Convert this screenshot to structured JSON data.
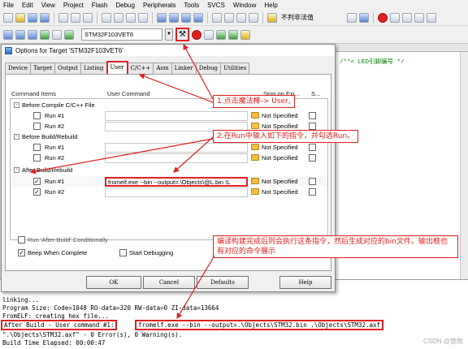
{
  "menubar": [
    "File",
    "Edit",
    "View",
    "Project",
    "Flash",
    "Debug",
    "Peripherals",
    "Tools",
    "SVCS",
    "Window",
    "Help"
  ],
  "toolbar": {
    "search_value": "不判非法值",
    "target_name": "STM32F103VET6"
  },
  "editor": {
    "code_line": "/**< LED引脚编号 */"
  },
  "dialog": {
    "title": "Options for Target 'STM32F103VET6'",
    "tabs": [
      "Device",
      "Target",
      "Output",
      "Listing",
      "User",
      "C/C++",
      "Asm",
      "Linker",
      "Debug",
      "Utilities"
    ],
    "active_tab": "User",
    "headers": {
      "command_items": "Command Items",
      "user_command": "User Command",
      "stop_on": "Stop on Exi...",
      "s": "S..."
    },
    "rows": [
      {
        "kind": "group",
        "label": "Before Compile C/C++ File",
        "expander": "-"
      },
      {
        "kind": "item",
        "label": "Run #1",
        "checked": false,
        "command": "",
        "stop": "Not Specified"
      },
      {
        "kind": "item",
        "label": "Run #2",
        "checked": false,
        "command": "",
        "stop": "Not Specified"
      },
      {
        "kind": "group",
        "label": "Before Build/Rebuild",
        "expander": "-"
      },
      {
        "kind": "item",
        "label": "Run #1",
        "checked": false,
        "command": "",
        "stop": "Not Specified"
      },
      {
        "kind": "item",
        "label": "Run #2",
        "checked": false,
        "command": "",
        "stop": "Not Specified"
      },
      {
        "kind": "group",
        "label": "After Build/Rebuild",
        "expander": "-"
      },
      {
        "kind": "item",
        "label": "Run #1",
        "checked": true,
        "command": "fromelf.exe --bin --output=.\\Objects\\@L.bin !L",
        "stop": "Not Specified"
      },
      {
        "kind": "item",
        "label": "Run #2",
        "checked": true,
        "command": "",
        "stop": "Not Specified"
      }
    ],
    "options": {
      "run_after_build_disabled": "Run 'After-Build' Conditionally",
      "beep": "Beep When Complete",
      "beep_checked": true,
      "start_debugging": "Start Debugging"
    },
    "buttons": {
      "ok": "OK",
      "cancel": "Cancel",
      "defaults": "Defaults",
      "help": "Help"
    }
  },
  "build_output": {
    "lines": [
      "linking...",
      "Program Size: Code=1048 RO-data=320 RW-data=0 ZI-data=13664",
      "FromELF: creating hex file...",
      "After Build - User command #1:",
      "\".\\Objects\\STM32.axf\" - 0 Error(s), 0 Warning(s).",
      "Build Time Elapsed:  00:00:47"
    ],
    "command_echo": "fromelf.exe --bin --output=.\\Objects\\STM32.bin .\\Objects\\STM32.axf"
  },
  "annotations": {
    "step1": "1.点击魔法棒-> User,",
    "step2": "2.在Run中输入如下的指令，并勾选Run。",
    "step3": "编译构建完成后则会执行这条指令，然后生成对应的bin文件。输出框也有对应的命令展示"
  },
  "watermark": "CSDN @悠牧",
  "colors": {
    "annotation": "#e02020"
  }
}
